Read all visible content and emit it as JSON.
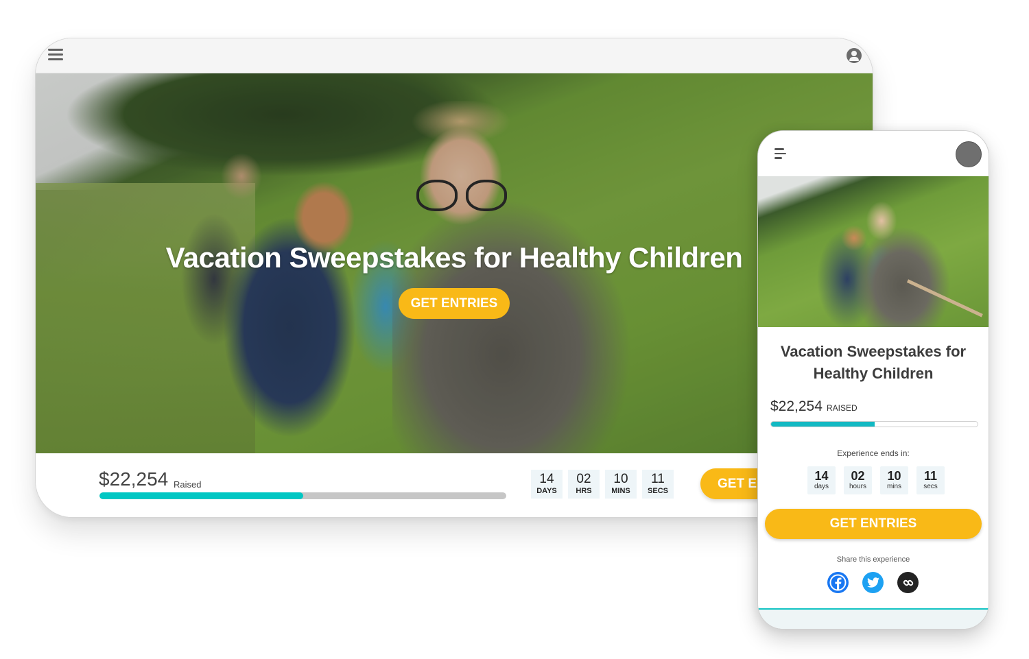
{
  "tablet": {
    "header": {
      "menu_icon": "hamburger-menu-icon",
      "account_icon": "user-account-icon"
    },
    "hero": {
      "title": "Vacation Sweepstakes for Healthy Children",
      "cta_label": "GET ENTRIES"
    },
    "footer": {
      "amount_raised": "$22,254",
      "raised_label": "Raised",
      "progress_fraction": 0.5,
      "countdown": [
        {
          "value": "14",
          "label": "DAYS"
        },
        {
          "value": "02",
          "label": "HRS"
        },
        {
          "value": "10",
          "label": "MINS"
        },
        {
          "value": "11",
          "label": "SECS"
        }
      ],
      "cta_label": "GET EN"
    }
  },
  "phone": {
    "header": {
      "menu_icon": "menu-icon",
      "avatar": "user-avatar"
    },
    "title": "Vacation Sweepstakes for Healthy Children",
    "amount_raised": "$22,254",
    "raised_label": "RAISED",
    "progress_fraction": 0.5,
    "countdown_heading": "Experience ends in:",
    "countdown": [
      {
        "value": "14",
        "label": "days"
      },
      {
        "value": "02",
        "label": "hours"
      },
      {
        "value": "10",
        "label": "mins"
      },
      {
        "value": "11",
        "label": "secs"
      }
    ],
    "cta_label": "GET ENTRIES",
    "share_label": "Share this experience",
    "share_buttons": [
      {
        "name": "facebook",
        "icon": "facebook-icon"
      },
      {
        "name": "twitter",
        "icon": "twitter-icon"
      },
      {
        "name": "copy-link",
        "icon": "link-icon"
      }
    ]
  },
  "colors": {
    "accent_yellow": "#f9b917",
    "progress_teal": "#00c7c3",
    "facebook_blue": "#1877f2",
    "twitter_blue": "#1da1f2",
    "link_dark": "#232323"
  }
}
